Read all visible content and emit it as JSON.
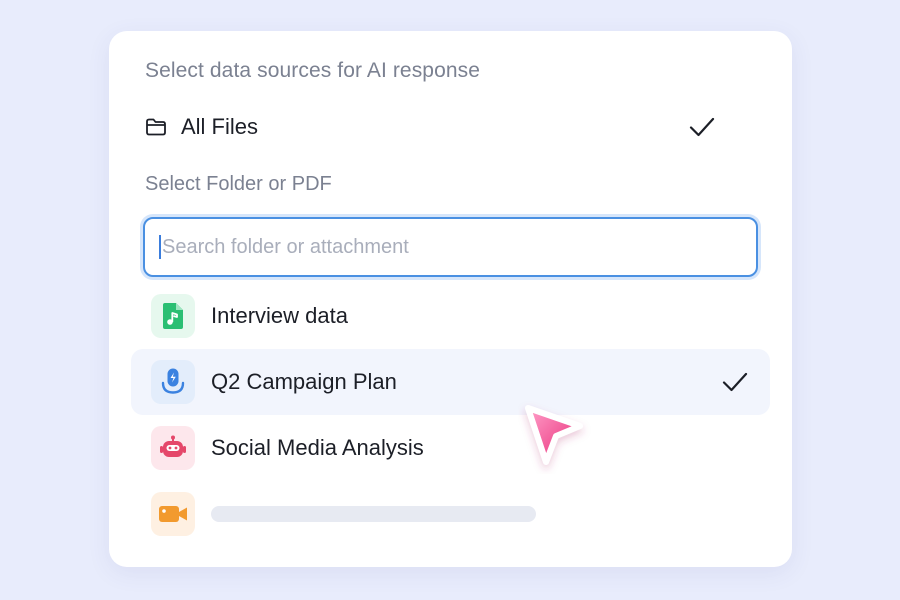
{
  "panel": {
    "title": "Select data sources for AI response",
    "all_files": {
      "label": "All Files",
      "checked": true
    },
    "folder_section_title": "Select Folder or PDF",
    "search": {
      "placeholder": "Search folder or attachment",
      "value": ""
    },
    "items": [
      {
        "label": "Interview data",
        "icon": "audio-file-icon",
        "icon_color": "#2bbf73",
        "icon_bg": "#e6f8ee",
        "selected": false
      },
      {
        "label": "Q2 Campaign Plan",
        "icon": "microphone-icon",
        "icon_color": "#3b82e0",
        "icon_bg": "#e3edfb",
        "selected": true
      },
      {
        "label": "Social Media Analysis",
        "icon": "robot-icon",
        "icon_color": "#e5476a",
        "icon_bg": "#fde7ec",
        "selected": false
      },
      {
        "label": "",
        "icon": "video-camera-icon",
        "icon_color": "#f29a2e",
        "icon_bg": "#fef0e2",
        "selected": false,
        "loading": true
      }
    ]
  },
  "colors": {
    "background": "#e8ecfc",
    "accent": "#4a90e2",
    "cursor": "#f25c9a"
  }
}
